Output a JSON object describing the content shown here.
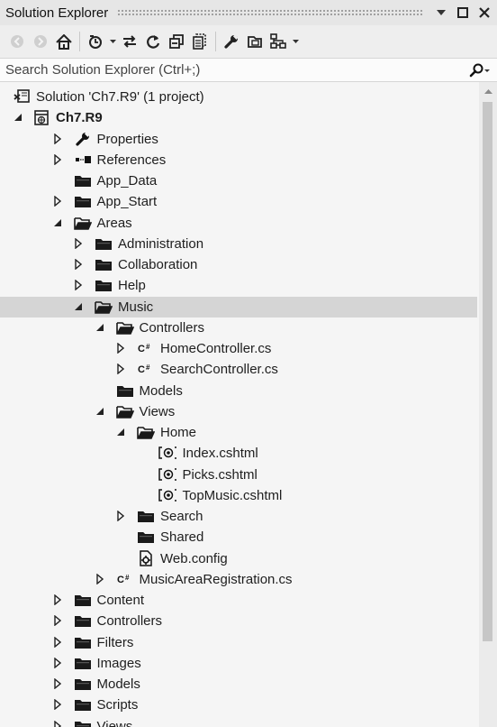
{
  "window": {
    "title": "Solution Explorer"
  },
  "search": {
    "placeholder": "Search Solution Explorer (Ctrl+;)"
  },
  "tree": [
    {
      "label": "Solution 'Ch7.R9' (1 project)",
      "depth": 0,
      "expander": "none",
      "icon": "solution-icon"
    },
    {
      "label": "Ch7.R9",
      "depth": 0,
      "expander": "expanded",
      "icon": "web-project-icon",
      "bold": true
    },
    {
      "label": "Properties",
      "depth": 1,
      "expander": "collapsed",
      "icon": "wrench-icon"
    },
    {
      "label": "References",
      "depth": 1,
      "expander": "collapsed",
      "icon": "references-icon"
    },
    {
      "label": "App_Data",
      "depth": 1,
      "expander": "none",
      "icon": "folder-icon"
    },
    {
      "label": "App_Start",
      "depth": 1,
      "expander": "collapsed",
      "icon": "folder-icon"
    },
    {
      "label": "Areas",
      "depth": 1,
      "expander": "expanded",
      "icon": "folder-open-icon"
    },
    {
      "label": "Administration",
      "depth": 2,
      "expander": "collapsed",
      "icon": "folder-icon"
    },
    {
      "label": "Collaboration",
      "depth": 2,
      "expander": "collapsed",
      "icon": "folder-icon"
    },
    {
      "label": "Help",
      "depth": 2,
      "expander": "collapsed",
      "icon": "folder-icon"
    },
    {
      "label": "Music",
      "depth": 2,
      "expander": "expanded",
      "icon": "folder-open-icon",
      "selected": true
    },
    {
      "label": "Controllers",
      "depth": 3,
      "expander": "expanded",
      "icon": "folder-open-icon"
    },
    {
      "label": "HomeController.cs",
      "depth": 4,
      "expander": "collapsed",
      "icon": "csharp-file-icon"
    },
    {
      "label": "SearchController.cs",
      "depth": 4,
      "expander": "collapsed",
      "icon": "csharp-file-icon"
    },
    {
      "label": "Models",
      "depth": 3,
      "expander": "none",
      "icon": "folder-icon"
    },
    {
      "label": "Views",
      "depth": 3,
      "expander": "expanded",
      "icon": "folder-open-icon"
    },
    {
      "label": "Home",
      "depth": 4,
      "expander": "expanded",
      "icon": "folder-open-icon"
    },
    {
      "label": "Index.cshtml",
      "depth": 5,
      "expander": "none",
      "icon": "razor-file-icon"
    },
    {
      "label": "Picks.cshtml",
      "depth": 5,
      "expander": "none",
      "icon": "razor-file-icon"
    },
    {
      "label": "TopMusic.cshtml",
      "depth": 5,
      "expander": "none",
      "icon": "razor-file-icon"
    },
    {
      "label": "Search",
      "depth": 4,
      "expander": "collapsed",
      "icon": "folder-icon"
    },
    {
      "label": "Shared",
      "depth": 4,
      "expander": "none",
      "icon": "folder-icon"
    },
    {
      "label": "Web.config",
      "depth": 4,
      "expander": "none",
      "icon": "config-file-icon"
    },
    {
      "label": "MusicAreaRegistration.cs",
      "depth": 3,
      "expander": "collapsed",
      "icon": "csharp-file-icon"
    },
    {
      "label": "Content",
      "depth": 1,
      "expander": "collapsed",
      "icon": "folder-icon"
    },
    {
      "label": "Controllers",
      "depth": 1,
      "expander": "collapsed",
      "icon": "folder-icon"
    },
    {
      "label": "Filters",
      "depth": 1,
      "expander": "collapsed",
      "icon": "folder-icon"
    },
    {
      "label": "Images",
      "depth": 1,
      "expander": "collapsed",
      "icon": "folder-icon"
    },
    {
      "label": "Models",
      "depth": 1,
      "expander": "collapsed",
      "icon": "folder-icon"
    },
    {
      "label": "Scripts",
      "depth": 1,
      "expander": "collapsed",
      "icon": "folder-icon"
    },
    {
      "label": "Views",
      "depth": 1,
      "expander": "collapsed",
      "icon": "folder-icon"
    }
  ]
}
